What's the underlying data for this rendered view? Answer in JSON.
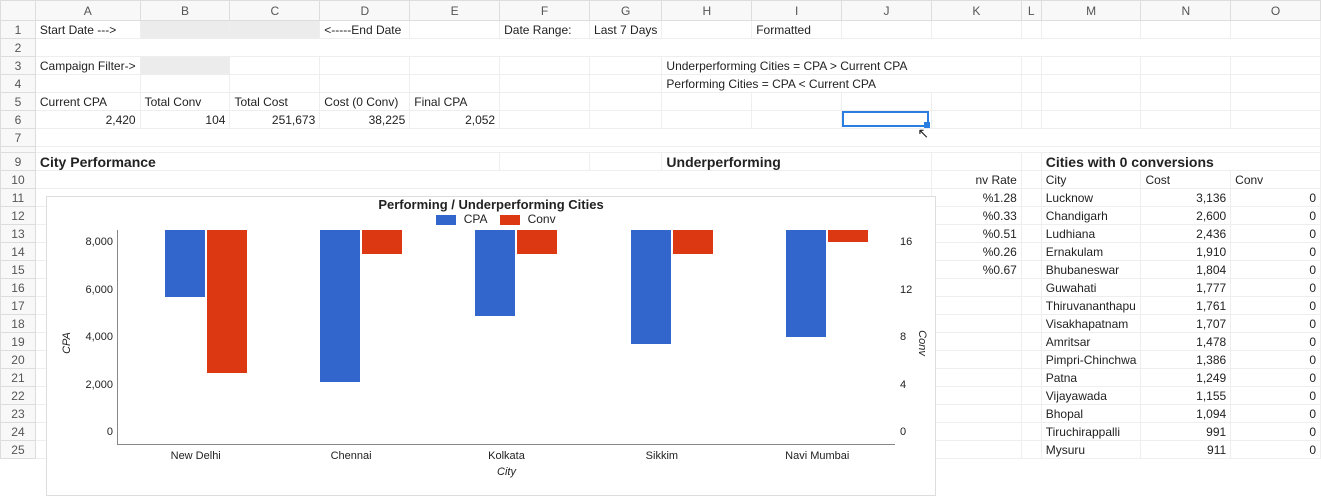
{
  "columns": [
    "A",
    "B",
    "C",
    "D",
    "E",
    "F",
    "G",
    "H",
    "I",
    "J",
    "K",
    "L",
    "M",
    "N",
    "O"
  ],
  "rows": [
    1,
    2,
    3,
    4,
    5,
    6,
    7,
    "",
    9,
    10,
    11,
    12,
    13,
    14,
    15,
    16,
    17,
    18,
    19,
    20,
    21,
    22,
    23,
    24,
    25
  ],
  "r1": {
    "A": "Start Date --->",
    "D": "<-----End Date",
    "F": "Date Range:",
    "G": "Last 7 Days",
    "I": "Formatted"
  },
  "r3": {
    "A": "Campaign Filter->",
    "H": "Underperforming Cities = CPA > Current CPA"
  },
  "r4": {
    "H": "Performing Cities = CPA < Current CPA"
  },
  "r5": {
    "A": "Current CPA",
    "B": "Total Conv",
    "C": "Total Cost",
    "D": "Cost (0 Conv)",
    "E": "Final CPA"
  },
  "r6": {
    "A": "2,420",
    "B": "104",
    "C": "251,673",
    "D": "38,225",
    "E": "2,052"
  },
  "r9": {
    "A": "City Performance",
    "H": "Underperforming",
    "M": "Cities with 0 conversions"
  },
  "r10": {
    "K": "nv Rate",
    "M": "City",
    "N": "Cost",
    "O": "Conv"
  },
  "conv_rates": [
    "%1.28",
    "%0.33",
    "%0.51",
    "%0.26",
    "%0.67"
  ],
  "zero_cities": [
    {
      "city": "Lucknow",
      "cost": "3,136",
      "conv": "0"
    },
    {
      "city": "Chandigarh",
      "cost": "2,600",
      "conv": "0"
    },
    {
      "city": "Ludhiana",
      "cost": "2,436",
      "conv": "0"
    },
    {
      "city": "Ernakulam",
      "cost": "1,910",
      "conv": "0"
    },
    {
      "city": "Bhubaneswar",
      "cost": "1,804",
      "conv": "0"
    },
    {
      "city": "Guwahati",
      "cost": "1,777",
      "conv": "0"
    },
    {
      "city": "Thiruvananthapu",
      "cost": "1,761",
      "conv": "0"
    },
    {
      "city": "Visakhapatnam",
      "cost": "1,707",
      "conv": "0"
    },
    {
      "city": "Amritsar",
      "cost": "1,478",
      "conv": "0"
    },
    {
      "city": "Pimpri-Chinchwa",
      "cost": "1,386",
      "conv": "0"
    },
    {
      "city": "Patna",
      "cost": "1,249",
      "conv": "0"
    },
    {
      "city": "Vijayawada",
      "cost": "1,155",
      "conv": "0"
    },
    {
      "city": "Bhopal",
      "cost": "1,094",
      "conv": "0"
    },
    {
      "city": "Tiruchirappalli",
      "cost": "991",
      "conv": "0"
    },
    {
      "city": "Mysuru",
      "cost": "911",
      "conv": "0"
    }
  ],
  "chart_data": {
    "type": "bar",
    "title": "Performing / Underperforming Cities",
    "categories": [
      "New Delhi",
      "Chennai",
      "Kolkata",
      "Sikkim",
      "Navi Mumbai"
    ],
    "series": [
      {
        "name": "CPA",
        "values": [
          2800,
          6400,
          3600,
          4800,
          4500
        ]
      },
      {
        "name": "Conv",
        "values": [
          12,
          2,
          2,
          2,
          1
        ]
      }
    ],
    "ylabel": "CPA",
    "y2label": "Conv",
    "xlabel": "City",
    "ylim": [
      0,
      8000
    ],
    "y2lim": [
      0,
      16
    ],
    "yticks": [
      "0",
      "2,000",
      "4,000",
      "6,000",
      "8,000"
    ],
    "y2ticks": [
      "0",
      "4",
      "8",
      "12",
      "16"
    ],
    "legend": [
      "CPA",
      "Conv"
    ]
  },
  "selection_cell": "J6"
}
